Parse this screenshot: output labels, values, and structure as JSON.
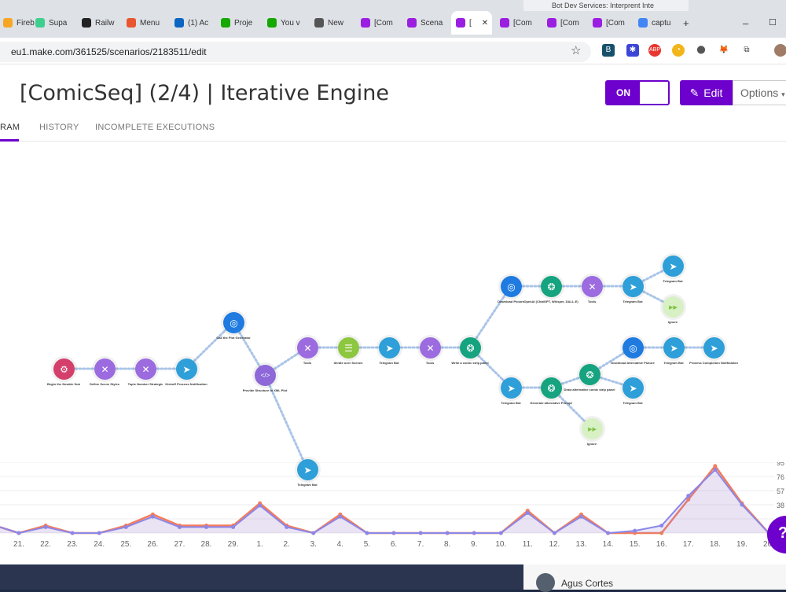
{
  "browser": {
    "tabs": [
      {
        "label": "Fireb",
        "color": "#f6a623"
      },
      {
        "label": "Supa",
        "color": "#3ecf8e"
      },
      {
        "label": "Railw",
        "color": "#222222"
      },
      {
        "label": "Menu",
        "color": "#e8552f"
      },
      {
        "label": "(1) Ac",
        "color": "#0a66c2"
      },
      {
        "label": "Proje",
        "color": "#14a800"
      },
      {
        "label": "You v",
        "color": "#14a800"
      },
      {
        "label": "New",
        "color": "#555555"
      },
      {
        "label": "[Com",
        "color": "#9b1fe0"
      },
      {
        "label": "Scena",
        "color": "#9b1fe0"
      },
      {
        "label": "[",
        "color": "#9b1fe0",
        "active": true
      },
      {
        "label": "[Com",
        "color": "#9b1fe0"
      },
      {
        "label": "[Com",
        "color": "#9b1fe0"
      },
      {
        "label": "[Com",
        "color": "#9b1fe0"
      },
      {
        "label": "captu",
        "color": "#4285f4"
      }
    ],
    "behind_window_tab": "Bot Dev Services: Interprent Inte",
    "url": "eu1.make.com/361525/scenarios/2183511/edit"
  },
  "header": {
    "title": "[ComicSeq] (2/4) | Iterative Engine",
    "toggle_label": "ON",
    "edit_label": "Edit",
    "options_label": "Options"
  },
  "nav_tabs": [
    "RAM",
    "HISTORY",
    "INCOMPLETE EXECUTIONS"
  ],
  "nodes": [
    {
      "id": "webhook",
      "label": "Begin the Newbie Sub",
      "color": "#d43f6b",
      "icon": "hook"
    },
    {
      "id": "tools1",
      "label": "Define Scene Styles",
      "color": "#9b6bdf",
      "icon": "tools"
    },
    {
      "id": "tools2",
      "label": "Topic Number Strategic",
      "color": "#9b6bdf",
      "icon": "tools"
    },
    {
      "id": "tg1",
      "label": "Kickoff Process Notification",
      "color": "#2e9fd8",
      "icon": "telegram"
    },
    {
      "id": "http1",
      "label": "Call the Plot Generator",
      "color": "#1f7be0",
      "icon": "globe"
    },
    {
      "id": "xml",
      "label": "Provide Structure to XML Plot",
      "color": "#8e68d8",
      "icon": "code"
    },
    {
      "id": "tg_down",
      "label": "Telegram Bot",
      "color": "#2e9fd8",
      "icon": "telegram"
    },
    {
      "id": "tools3",
      "label": "Tools",
      "color": "#9b6bdf",
      "icon": "tools"
    },
    {
      "id": "iter",
      "label": "Iterate over Scenes",
      "color": "#8dc63f",
      "icon": "list"
    },
    {
      "id": "tg2",
      "label": "Telegram Bot",
      "color": "#2e9fd8",
      "icon": "telegram"
    },
    {
      "id": "tools4",
      "label": "Tools",
      "color": "#9b6bdf",
      "icon": "tools"
    },
    {
      "id": "gpt1",
      "label": "Write a comic strip panel",
      "color": "#16a37f",
      "icon": "gpt"
    },
    {
      "id": "http2",
      "label": "Download Picture",
      "color": "#1f7be0",
      "icon": "globe"
    },
    {
      "id": "gpt2",
      "label": "OpenAI (ChatGPT, Whisper, DALL-E)",
      "color": "#16a37f",
      "icon": "gpt"
    },
    {
      "id": "tools5",
      "label": "Tools",
      "color": "#9b6bdf",
      "icon": "tools"
    },
    {
      "id": "tg3",
      "label": "Telegram Bot",
      "color": "#2e9fd8",
      "icon": "telegram"
    },
    {
      "id": "tg4",
      "label": "Telegram Bot",
      "color": "#2e9fd8",
      "icon": "telegram"
    },
    {
      "id": "ignore1",
      "label": "Ignore",
      "color": "#d7f0c4",
      "icon": "skip"
    },
    {
      "id": "tg5",
      "label": "Telegram Bot",
      "color": "#2e9fd8",
      "icon": "telegram"
    },
    {
      "id": "gpt3",
      "label": "Generate alternative Prompt",
      "color": "#16a37f",
      "icon": "gpt"
    },
    {
      "id": "gpt4",
      "label": "Draw alternative comic strip panel",
      "color": "#16a37f",
      "icon": "gpt"
    },
    {
      "id": "http3",
      "label": "Download Alternative Picture",
      "color": "#1f7be0",
      "icon": "globe"
    },
    {
      "id": "tg6",
      "label": "Telegram Bot",
      "color": "#2e9fd8",
      "icon": "telegram"
    },
    {
      "id": "tg7",
      "label": "Process Completion Notification",
      "color": "#2e9fd8",
      "icon": "telegram"
    },
    {
      "id": "tg8",
      "label": "Telegram Bot",
      "color": "#2e9fd8",
      "icon": "telegram"
    },
    {
      "id": "ignore2",
      "label": "Ignore",
      "color": "#d7f0c4",
      "icon": "skip"
    }
  ],
  "chart_data": {
    "type": "area",
    "x": [
      "21.",
      "22.",
      "23.",
      "24.",
      "25.",
      "26.",
      "27.",
      "28.",
      "29.",
      "1.",
      "2.",
      "3.",
      "4.",
      "5.",
      "6.",
      "7.",
      "8.",
      "9.",
      "10.",
      "11.",
      "12.",
      "13.",
      "14.",
      "15.",
      "16.",
      "17.",
      "18.",
      "19.",
      "20."
    ],
    "y_ticks": [
      "95",
      "76",
      "57",
      "38"
    ],
    "series": [
      {
        "values": [
          0,
          10,
          0,
          0,
          10,
          25,
          10,
          10,
          10,
          40,
          10,
          0,
          25,
          0,
          0,
          0,
          0,
          0,
          0,
          30,
          0,
          25,
          0,
          0,
          0,
          45,
          90,
          40,
          0
        ],
        "color": "#f57c5a"
      },
      {
        "values": [
          0,
          8,
          0,
          0,
          8,
          22,
          8,
          8,
          8,
          37,
          8,
          0,
          22,
          0,
          0,
          0,
          0,
          0,
          0,
          27,
          0,
          22,
          0,
          3,
          10,
          50,
          85,
          38,
          0
        ],
        "color": "#8c86e8"
      }
    ]
  },
  "footer": {
    "user_name": "Agus Cortes",
    "chat_icon": "?"
  }
}
